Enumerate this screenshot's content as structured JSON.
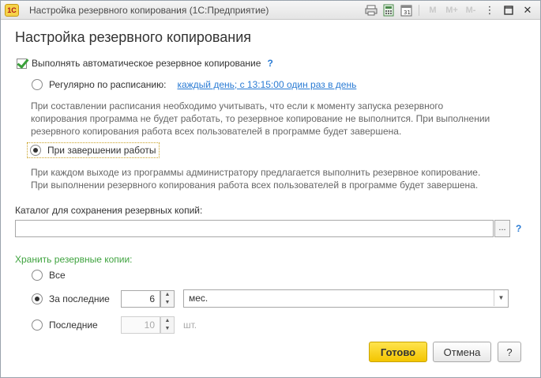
{
  "window": {
    "app_logo": "1C",
    "title": "Настройка резервного копирования  (1С:Предприятие)",
    "toolbar_m": [
      "M",
      "M+",
      "M-"
    ]
  },
  "form": {
    "title": "Настройка резервного копирования",
    "auto_backup_label": "Выполнять автоматическое резервное копирование",
    "help_mark": "?",
    "schedule": {
      "label": "Регулярно по расписанию:",
      "link": "каждый день; с 13:15:00 один раз в день",
      "note": [
        "При составлении расписания необходимо учитывать, что если к моменту запуска резервного",
        "копирования программа не будет работать, то резервное копирование не выполнится. При выполнении",
        "резервного копирования работа всех пользователей в программе будет завершена."
      ]
    },
    "on_exit": {
      "label": "При завершении работы",
      "note": [
        "При каждом выходе из программы администратору предлагается выполнить резервное копирование.",
        "При выполнении резервного копирования работа всех пользователей в программе будет завершена."
      ]
    },
    "directory": {
      "label": "Каталог для сохранения резервных копий:",
      "value": "",
      "select_label": "...",
      "help_mark": "?"
    },
    "keep": {
      "label": "Хранить резервные копии:",
      "all_label": "Все",
      "last_period_label": "За последние",
      "last_period_value": "6",
      "period_unit": "мес.",
      "last_count_label": "Последние",
      "last_count_value": "10",
      "count_unit": "шт."
    },
    "buttons": {
      "done": "Готово",
      "cancel": "Отмена",
      "help": "?"
    }
  }
}
